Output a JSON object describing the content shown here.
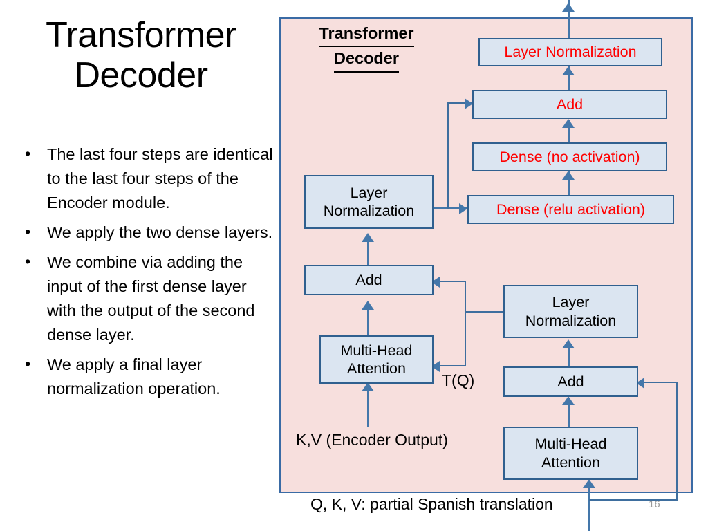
{
  "slide": {
    "title": "Transformer\nDecoder",
    "title_line1": "Transformer",
    "title_line2": "Decoder",
    "number": "16"
  },
  "bullets": [
    "The last four steps are identical to the last four steps of the Encoder module.",
    "We apply the two dense layers.",
    "We combine via adding the input of the first dense layer with the output of the second dense layer.",
    "We apply a final layer normalization operation."
  ],
  "bullet_marker": "•",
  "diagram": {
    "heading_line1": "Transformer",
    "heading_line2": "Decoder",
    "colors": {
      "panel_background": "#f7dfdd",
      "panel_border": "#3a6ba5",
      "block_fill": "#dbe5f1",
      "block_border": "#30608f",
      "red_text": "#ff0000",
      "black_text": "#000000",
      "arrow": "#4477aa"
    },
    "blocks": [
      {
        "id": "top-layer-norm",
        "label": "Layer Normalization",
        "text_color": "red"
      },
      {
        "id": "top-add",
        "label": "Add",
        "text_color": "red"
      },
      {
        "id": "dense-no-activation",
        "label": "Dense (no activation)",
        "text_color": "red"
      },
      {
        "id": "dense-relu-activation",
        "label": "Dense (relu activation)",
        "text_color": "red"
      },
      {
        "id": "mid-layer-norm",
        "label": "Layer\nNormalization",
        "text_color": "black"
      },
      {
        "id": "mid-add",
        "label": "Add",
        "text_color": "black"
      },
      {
        "id": "mid-multi-head",
        "label": "Multi-Head\nAttention",
        "text_color": "black"
      },
      {
        "id": "right-layer-norm",
        "label": "Layer\nNormalization",
        "text_color": "black"
      },
      {
        "id": "right-add",
        "label": "Add",
        "text_color": "black"
      },
      {
        "id": "right-multi-head",
        "label": "Multi-Head\nAttention",
        "text_color": "black"
      }
    ],
    "labels": {
      "tq": "T(Q)",
      "kv_encoder_output": "K,V (Encoder Output)",
      "qkv_partial": "Q, K, V: partial Spanish translation"
    }
  }
}
